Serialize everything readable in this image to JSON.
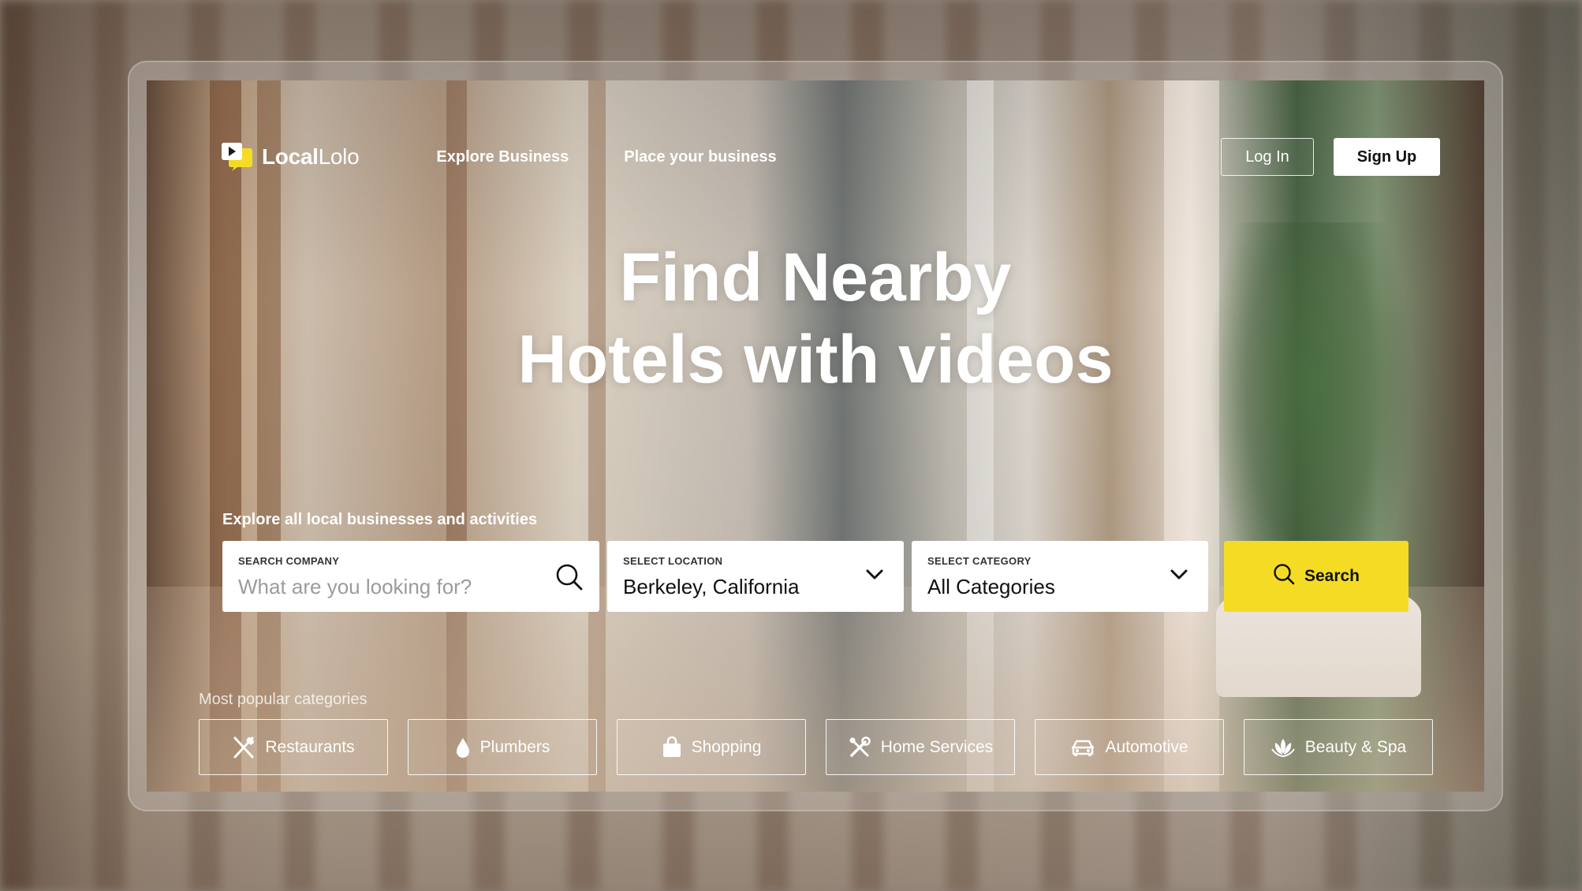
{
  "brand": {
    "name_bold": "Local",
    "name_regular": "Lolo",
    "accent": "#f4dc25"
  },
  "nav": {
    "links": [
      "Explore Business",
      "Place your business"
    ],
    "login_label": "Log In",
    "signup_label": "Sign Up"
  },
  "hero": {
    "headline_line1": "Find Nearby",
    "headline_line2": "Hotels with videos",
    "subtext": "Explore all local businesses and activities"
  },
  "search": {
    "company_label": "SEARCH COMPANY",
    "company_placeholder": "What are you looking for?",
    "location_label": "SELECT LOCATION",
    "location_value": "Berkeley, California",
    "category_label": "SELECT CATEGORY",
    "category_value": "All Categories",
    "button_label": "Search",
    "icons": {
      "company": "search-icon",
      "location": "chevron-down-icon",
      "category": "chevron-down-icon",
      "button": "search-icon"
    }
  },
  "categories": {
    "label": "Most popular categories",
    "items": [
      {
        "label": "Restaurants",
        "icon": "fork-knife-icon"
      },
      {
        "label": "Plumbers",
        "icon": "water-drop-icon"
      },
      {
        "label": "Shopping",
        "icon": "shopping-bag-icon"
      },
      {
        "label": "Home Services",
        "icon": "tools-icon"
      },
      {
        "label": "Automotive",
        "icon": "car-icon"
      },
      {
        "label": "Beauty & Spa",
        "icon": "lotus-icon"
      }
    ]
  }
}
